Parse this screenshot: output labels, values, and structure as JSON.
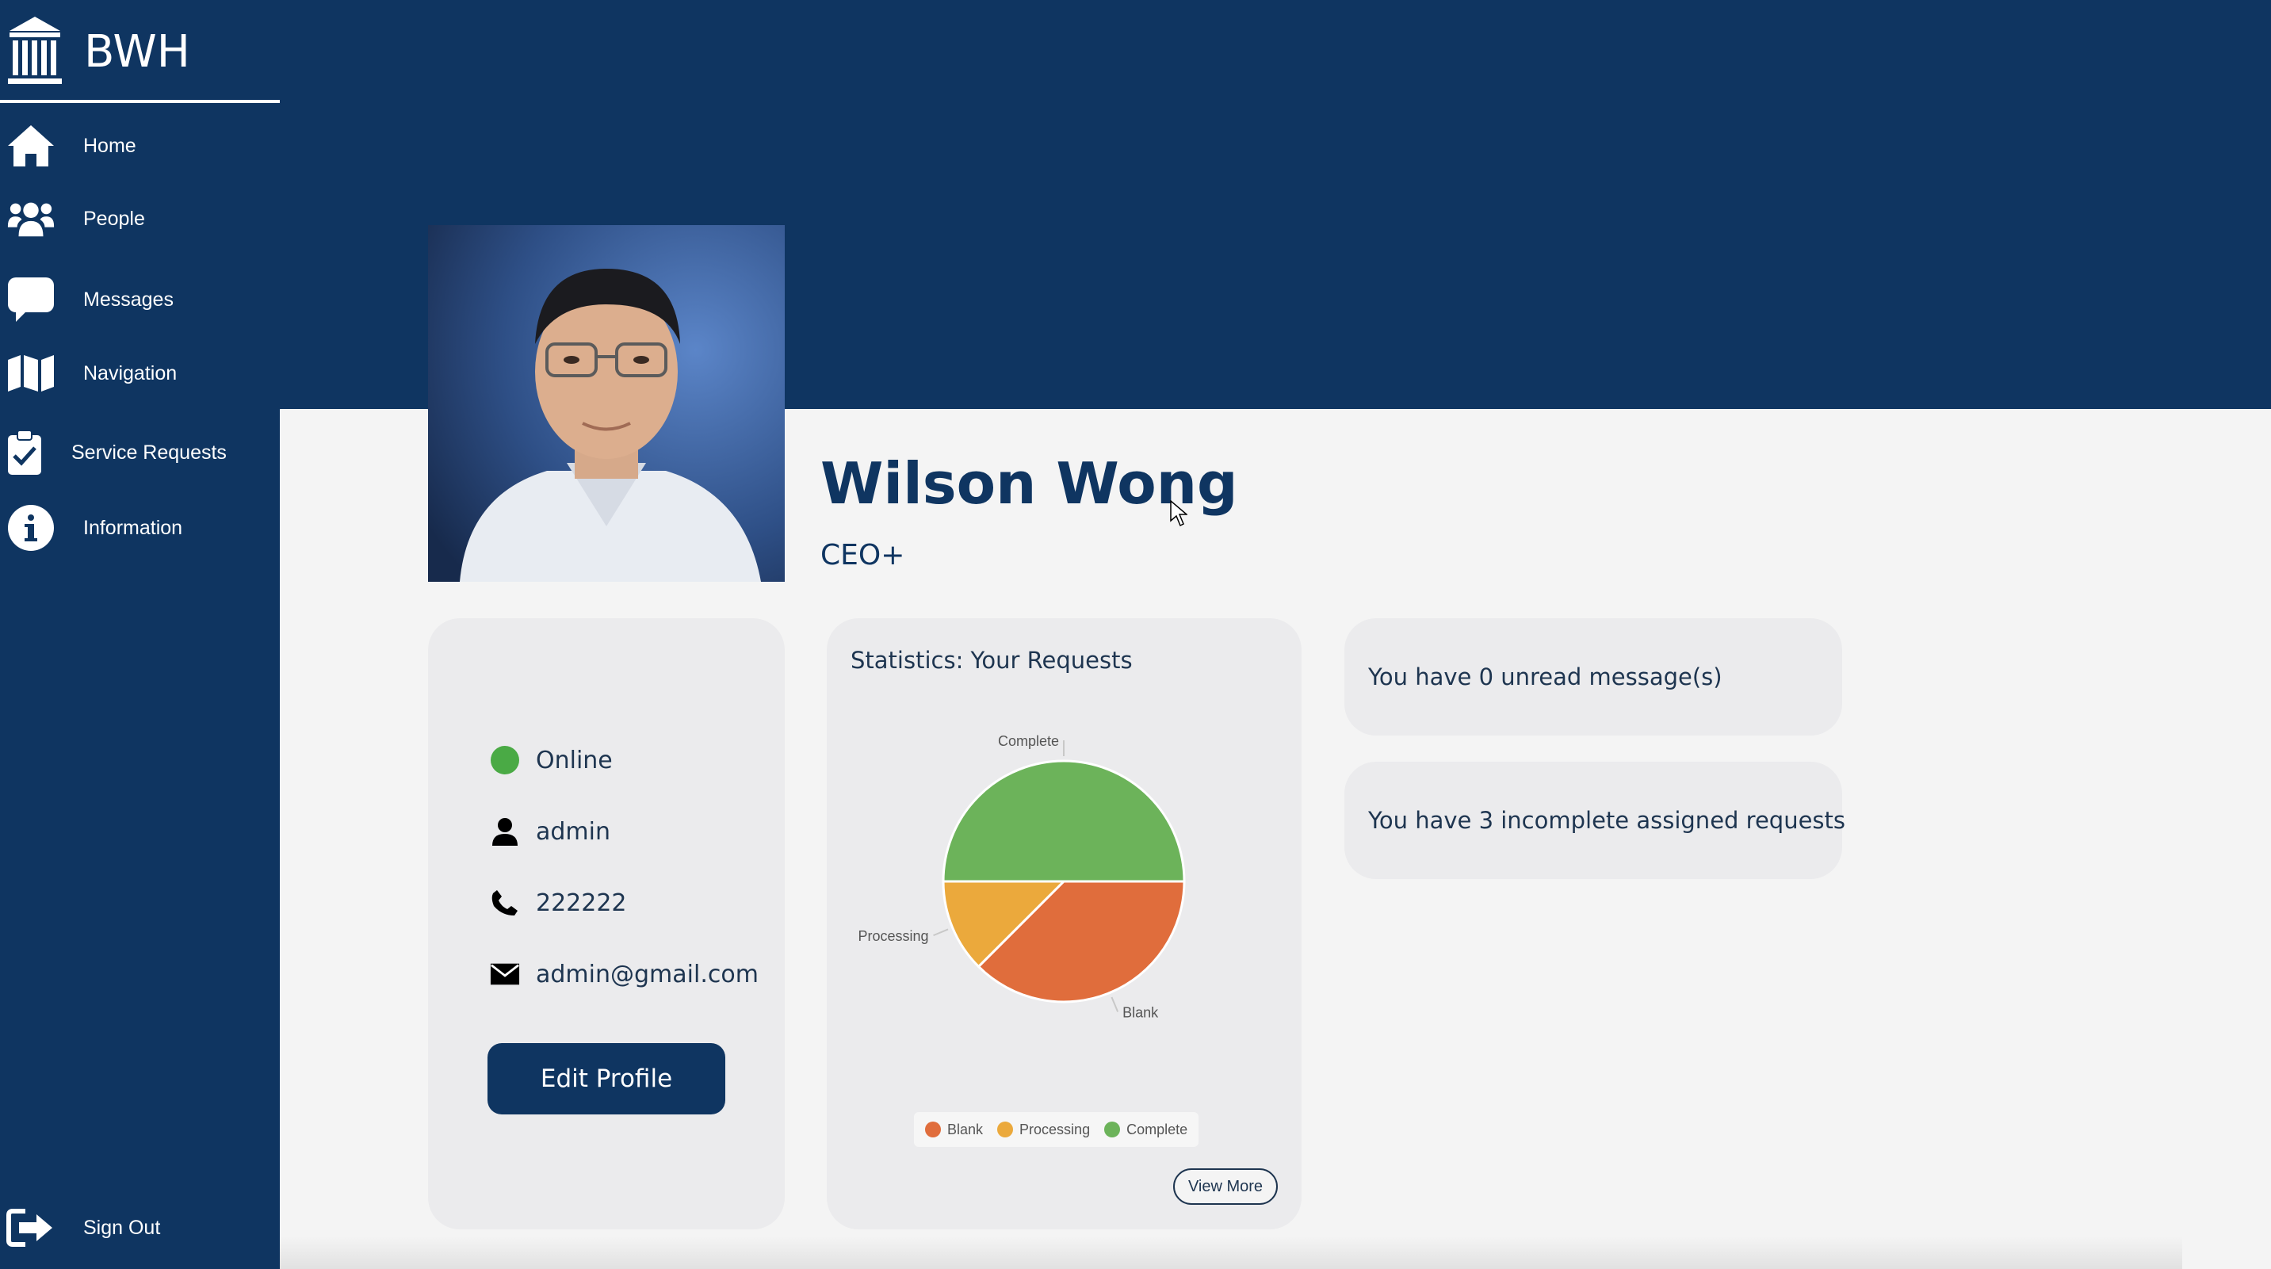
{
  "brand": {
    "name": "BWH",
    "icon": "institution-columns-icon"
  },
  "sidebar": {
    "items": [
      {
        "label": "Home",
        "icon": "home-icon"
      },
      {
        "label": "People",
        "icon": "people-icon"
      },
      {
        "label": "Messages",
        "icon": "message-bubble-icon"
      },
      {
        "label": "Navigation",
        "icon": "map-icon"
      },
      {
        "label": "Service Requests",
        "icon": "clipboard-check-icon"
      },
      {
        "label": "Information",
        "icon": "info-icon"
      }
    ],
    "sign_out": {
      "label": "Sign Out",
      "icon": "sign-out-icon"
    }
  },
  "profile": {
    "name": "Wilson Wong",
    "role": "CEO+",
    "status": "Online",
    "username": "admin",
    "phone": "222222",
    "email": "admin@gmail.com",
    "edit_button": "Edit Profile"
  },
  "statistics": {
    "title": "Statistics: Your Requests",
    "view_more": "View More"
  },
  "chart_data": {
    "type": "pie",
    "title": "Statistics: Your Requests",
    "slices": [
      {
        "label": "Blank",
        "value": 3,
        "color": "#e06d3c"
      },
      {
        "label": "Processing",
        "value": 1,
        "color": "#eba93c"
      },
      {
        "label": "Complete",
        "value": 4,
        "color": "#6cb35a"
      }
    ],
    "legend": [
      "Blank",
      "Processing",
      "Complete"
    ],
    "legend_position": "bottom"
  },
  "notices": {
    "unread_messages": "You have 0 unread message(s)",
    "incomplete_requests": "You have 3 incomplete assigned requests"
  },
  "colors": {
    "primary": "#0f3561",
    "background": "#f4f4f4",
    "card": "#ebebed",
    "online": "#4aaa45"
  }
}
